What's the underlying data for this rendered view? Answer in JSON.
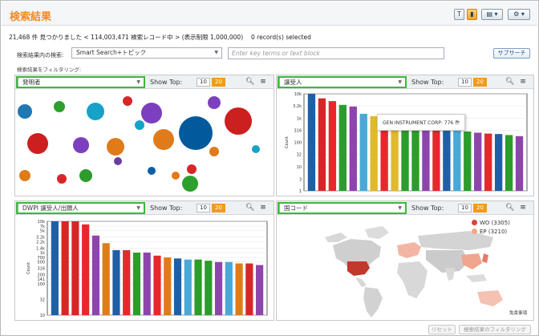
{
  "header": {
    "title": "検索結果",
    "buttons": [
      "T",
      "",
      "▤ ▾",
      "⚙ ▾"
    ]
  },
  "status_text": "21,468 件 見つかりました < 114,003,471 検索レコード中 > (表示制限 1,000,000)　 0 record(s) selected",
  "search": {
    "label": "検索結果内の検索:",
    "mode_value": "Smart Search+トピック",
    "placeholder": "Enter key terms or text block",
    "subsearch_label": "サブサーチ"
  },
  "filter_label": "検索結果をフィルタリング:",
  "panels": [
    {
      "selector": "発明者",
      "show_top_label": "Show Top:",
      "top10": "10",
      "top20": "20"
    },
    {
      "selector": "譲受人",
      "show_top_label": "Show Top:",
      "top10": "10",
      "top20": "20",
      "tooltip": "GEN INSTRUMENT CORP: 776 件"
    },
    {
      "selector": "DWPI 譲受人/出願人",
      "show_top_label": "Show Top:",
      "top10": "10",
      "top20": "20"
    },
    {
      "selector": "国コード",
      "show_top_label": "Show Top:",
      "top10": "10",
      "top20": "20",
      "legend": [
        {
          "label": "WO (3305)",
          "color": "#d9433a"
        },
        {
          "label": "EP (3210)",
          "color": "#f4a58a"
        }
      ],
      "credit": "免責事項"
    }
  ],
  "footer": {
    "reset_label": "リセット",
    "apply_label": "検索結果のフィルタリング"
  },
  "colors": {
    "accent": "#f08a24",
    "highlight": "#3cb83c"
  },
  "chart_data": [
    {
      "type": "scatter",
      "title": "",
      "note": "bubble chart of top inventors; sizes shown relative",
      "series": [
        {
          "values": [
            {
              "color": "#1f77b4",
              "r": 9
            },
            {
              "color": "#2ca02c",
              "r": 7
            },
            {
              "color": "#17a2c8",
              "r": 11
            },
            {
              "color": "#d62728",
              "r": 6
            },
            {
              "color": "#7b3fbf",
              "r": 10
            },
            {
              "color": "#cc1f1f",
              "r": 13
            },
            {
              "color": "#e07b1a",
              "r": 11
            },
            {
              "color": "#005a9c",
              "r": 21
            },
            {
              "color": "#cc1f1f",
              "r": 17
            },
            {
              "color": "#7b3fbf",
              "r": 13
            },
            {
              "color": "#6a3da1",
              "r": 5
            },
            {
              "color": "#2c9c2c",
              "r": 8
            },
            {
              "color": "#e07b1a",
              "r": 13
            },
            {
              "color": "#e07b1a",
              "r": 7
            },
            {
              "color": "#0e5ea8",
              "r": 5
            },
            {
              "color": "#e07b1a",
              "r": 5
            },
            {
              "color": "#d62728",
              "r": 6
            },
            {
              "color": "#17a2c8",
              "r": 5
            },
            {
              "color": "#2ca02c",
              "r": 10
            },
            {
              "color": "#e07b1a",
              "r": 6
            },
            {
              "color": "#17a2c8",
              "r": 6
            },
            {
              "color": "#7b3fbf",
              "r": 8
            },
            {
              "color": "#d62728",
              "r": 6
            }
          ]
        }
      ]
    },
    {
      "type": "bar",
      "ylabel": "Count",
      "yticks": [
        "1",
        "3",
        "10",
        "32",
        "100",
        "316",
        "1k",
        "3.2k",
        "10k"
      ],
      "log_scale": true,
      "values": [
        10000,
        6500,
        5000,
        3500,
        3000,
        1500,
        1200,
        700,
        600,
        500,
        400,
        380,
        320,
        300,
        300,
        280,
        250,
        230,
        220,
        200,
        180
      ],
      "colors": [
        "#1f5fa8",
        "#d62728",
        "#e6282d",
        "#2c9c2c",
        "#8e44ad",
        "#4aa8d6",
        "#e1b92f",
        "#e6282d",
        "#e1b92f",
        "#2c9c2c",
        "#2c9c2c",
        "#8e44ad",
        "#e6282d",
        "#1f5fa8",
        "#4aa8d6",
        "#2c9c2c",
        "#8e44ad",
        "#e6282d",
        "#1f5fa8",
        "#2c9c2c",
        "#8e44ad"
      ]
    },
    {
      "type": "bar",
      "ylabel": "Count",
      "yticks": [
        "10",
        "32",
        "100",
        "141",
        "200",
        "316",
        "500",
        "700",
        "1k",
        "1.4k",
        "2.2k",
        "3.2k",
        "5k",
        "7k",
        "10k"
      ],
      "log_scale": true,
      "values": [
        10000,
        10000,
        10000,
        8000,
        3500,
        2000,
        1200,
        1200,
        1000,
        1000,
        800,
        700,
        650,
        600,
        600,
        550,
        500,
        500,
        450,
        450,
        400
      ],
      "colors": [
        "#1f5fa8",
        "#d62728",
        "#d62728",
        "#e6282d",
        "#8e44ad",
        "#e07b1a",
        "#1f5fa8",
        "#e6282d",
        "#2c9c2c",
        "#8e44ad",
        "#e6282d",
        "#e07b1a",
        "#1f5fa8",
        "#4aa8d6",
        "#2c9c2c",
        "#2c9c2c",
        "#8e44ad",
        "#4aa8d6",
        "#e07b1a",
        "#d62728",
        "#8e44ad"
      ]
    }
  ]
}
